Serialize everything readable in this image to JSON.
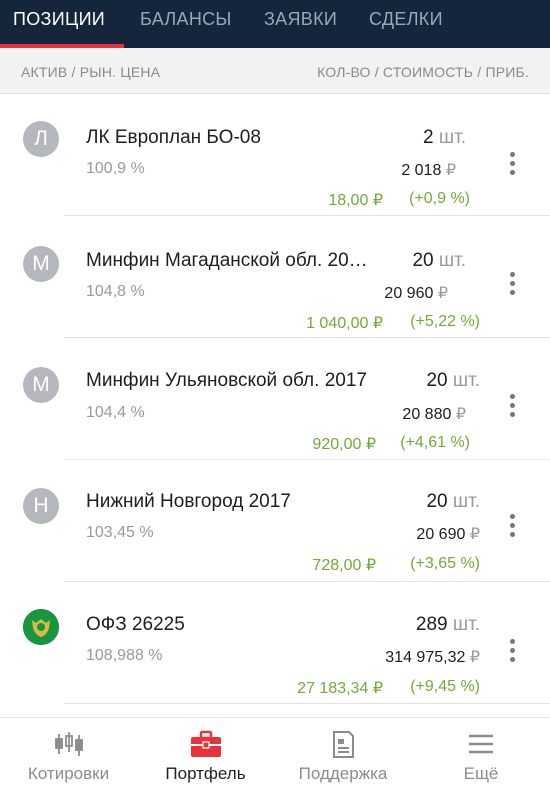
{
  "tabs": [
    {
      "label": "ПОЗИЦИИ",
      "active": true
    },
    {
      "label": "БАЛАНСЫ",
      "active": false
    },
    {
      "label": "ЗАЯВКИ",
      "active": false
    },
    {
      "label": "СДЕЛКИ",
      "active": false
    }
  ],
  "column_header": {
    "left": "АКТИВ / РЫН. ЦЕНА",
    "right": "КОЛ-ВО / СТОИМОСТЬ / ПРИБ."
  },
  "positions": [
    {
      "avatar": "Л",
      "name": "ЛК Европлан БО-08",
      "qty": "2",
      "qty_unit": "шт.",
      "price": "100,9",
      "price_unit": "%",
      "value": "2 018",
      "value_cur": "₽",
      "profit": "18,00",
      "profit_cur": "₽",
      "profit_pct": "(+0,9 %)"
    },
    {
      "avatar": "М",
      "name": "Минфин Магаданской обл. 20…",
      "qty": "20",
      "qty_unit": "шт.",
      "price": "104,8",
      "price_unit": "%",
      "value": "20 960",
      "value_cur": "₽",
      "profit": "1 040,00",
      "profit_cur": "₽",
      "profit_pct": "(+5,22 %)"
    },
    {
      "avatar": "М",
      "name": "Минфин Ульяновской обл. 2017",
      "qty": "20",
      "qty_unit": "шт.",
      "price": "104,4",
      "price_unit": "%",
      "value": "20 880",
      "value_cur": "₽",
      "profit": "920,00",
      "profit_cur": "₽",
      "profit_pct": "(+4,61 %)"
    },
    {
      "avatar": "Н",
      "name": "Нижний Новгород 2017",
      "qty": "20",
      "qty_unit": "шт.",
      "price": "103,45",
      "price_unit": "%",
      "value": "20 690",
      "value_cur": "₽",
      "profit": "728,00",
      "profit_cur": "₽",
      "profit_pct": "(+3,65 %)"
    },
    {
      "avatar": "",
      "avatar_icon": "coat-of-arms-icon",
      "name": "ОФЗ 26225",
      "qty": "289",
      "qty_unit": "шт.",
      "price": "108,988",
      "price_unit": "%",
      "value": "314 975,32",
      "value_cur": "₽",
      "profit": "27 183,34",
      "profit_cur": "₽",
      "profit_pct": "(+9,45 %)"
    }
  ],
  "bottom_nav": [
    {
      "label": "Котировки",
      "icon": "candlestick-icon",
      "active": false
    },
    {
      "label": "Портфель",
      "icon": "briefcase-icon",
      "active": true
    },
    {
      "label": "Поддержка",
      "icon": "document-icon",
      "active": false
    },
    {
      "label": "Ещё",
      "icon": "menu-icon",
      "active": false
    }
  ],
  "colors": {
    "topbar": "#14263c",
    "accent": "#e8333a",
    "profit": "#76a83a",
    "emblem": "#17953f"
  }
}
